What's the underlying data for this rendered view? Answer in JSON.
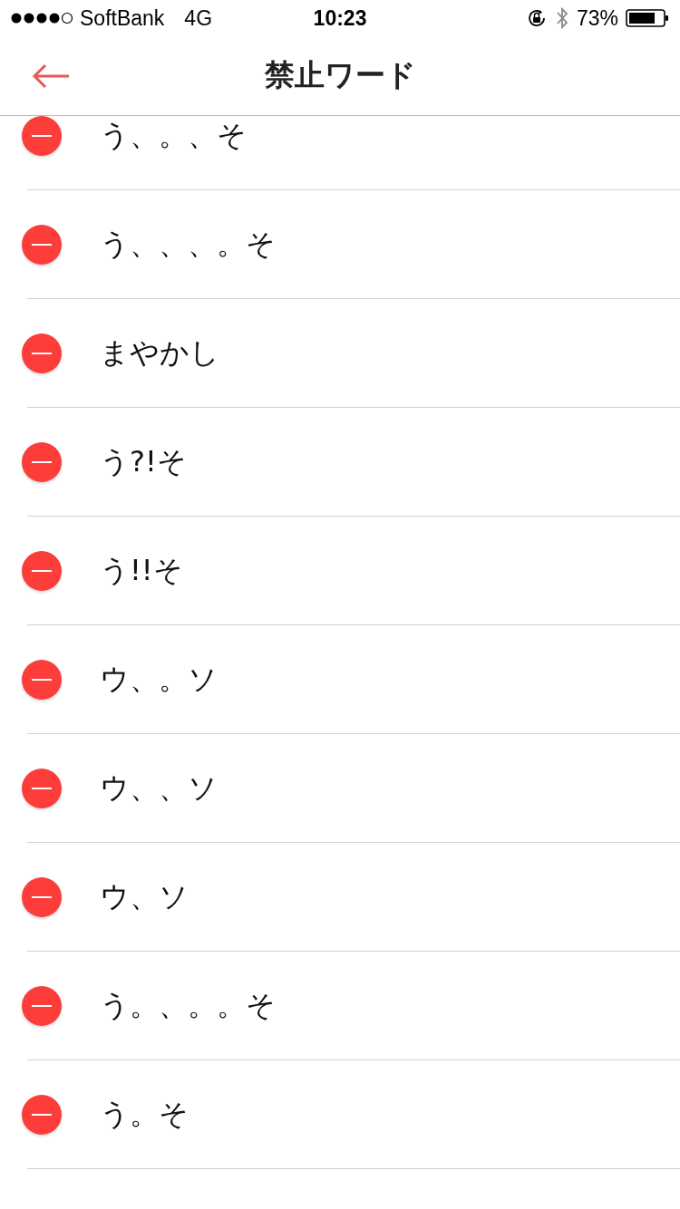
{
  "status_bar": {
    "carrier": "SoftBank",
    "network": "4G",
    "time": "10:23",
    "battery": "73%"
  },
  "nav": {
    "title": "禁止ワード"
  },
  "words": [
    {
      "text": "う、。、そ"
    },
    {
      "text": "う、、、。そ"
    },
    {
      "text": "まやかし"
    },
    {
      "text": "う?!そ"
    },
    {
      "text": "う!!そ"
    },
    {
      "text": "ウ、。ソ"
    },
    {
      "text": "ウ、、ソ"
    },
    {
      "text": "ウ、ソ"
    },
    {
      "text": "う。、。。そ"
    },
    {
      "text": "う。そ"
    }
  ]
}
